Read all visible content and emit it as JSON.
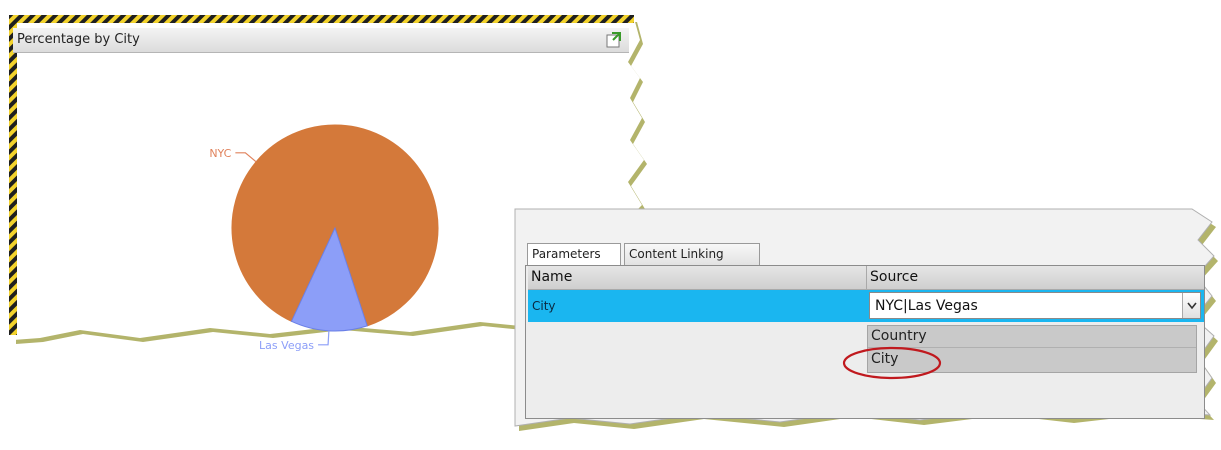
{
  "chart_panel": {
    "title": "Percentage by City",
    "export_icon": "export-icon"
  },
  "chart_data": {
    "type": "pie",
    "categories": [
      "NYC",
      "Las Vegas"
    ],
    "values": [
      88,
      12
    ],
    "colors": [
      "#d4793a",
      "#8c9ef8"
    ],
    "label_colors": [
      "#e0825c",
      "#8c9ef8"
    ],
    "title": "Percentage by City"
  },
  "param_panel": {
    "tabs": [
      {
        "label": "Parameters",
        "active": true
      },
      {
        "label": "Content Linking",
        "active": false
      }
    ],
    "columns": {
      "name": "Name",
      "source": "Source"
    },
    "rows": [
      {
        "name": "City",
        "source": "NYC|Las Vegas",
        "selected": true
      }
    ],
    "dropdown_options": [
      "Country",
      "City"
    ],
    "dropdown_icon": "chevron-down-icon",
    "selected_color": "#1ab6f0",
    "annotation_color": "#c0191e"
  }
}
